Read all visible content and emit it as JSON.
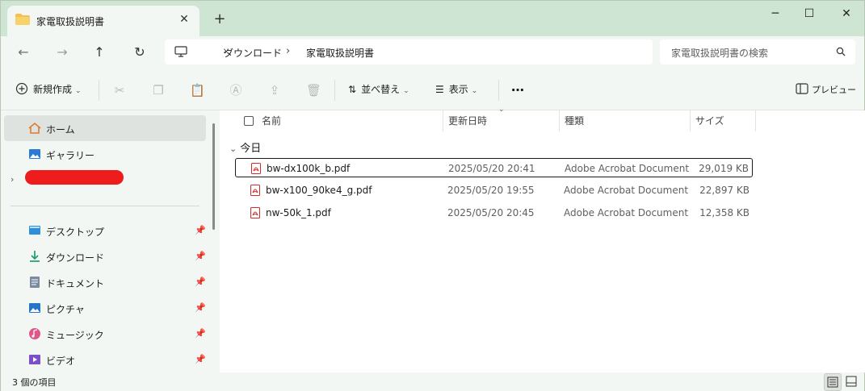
{
  "window": {
    "tab_title": "家電取扱説明書",
    "tab_close": "✕",
    "new_tab": "+",
    "controls": {
      "minimize": "─",
      "maximize": "☐",
      "close": "✕"
    }
  },
  "address": {
    "crumbs": [
      "ダウンロード",
      "家電取扱説明書"
    ],
    "separator": "›",
    "search_placeholder": "家電取扱説明書の検索"
  },
  "commands": {
    "new": "新規作成",
    "sort": "並べ替え",
    "view": "表示",
    "more": "…",
    "preview": "プレビュー"
  },
  "sidebar": {
    "top_items": [
      {
        "label": "ホーム",
        "icon": "home-icon",
        "selected": true
      },
      {
        "label": "ギャラリー",
        "icon": "gallery-icon",
        "selected": false
      }
    ],
    "pinned_items": [
      {
        "label": "デスクトップ",
        "icon": "desktop-icon"
      },
      {
        "label": "ダウンロード",
        "icon": "download-icon"
      },
      {
        "label": "ドキュメント",
        "icon": "documents-icon"
      },
      {
        "label": "ピクチャ",
        "icon": "pictures-icon"
      },
      {
        "label": "ミュージック",
        "icon": "music-icon"
      },
      {
        "label": "ビデオ",
        "icon": "videos-icon"
      }
    ]
  },
  "list": {
    "columns": [
      "名前",
      "更新日時",
      "種類",
      "サイズ"
    ],
    "group": "今日",
    "rows": [
      {
        "name": "bw-dx100k_b.pdf",
        "date": "2025/05/20 20:41",
        "type": "Adobe Acrobat Document",
        "size": "29,019 KB"
      },
      {
        "name": "bw-x100_90ke4_g.pdf",
        "date": "2025/05/20 19:55",
        "type": "Adobe Acrobat Document",
        "size": "22,897 KB"
      },
      {
        "name": "nw-50k_1.pdf",
        "date": "2025/05/20 20:45",
        "type": "Adobe Acrobat Document",
        "size": "12,358 KB"
      }
    ]
  },
  "status": {
    "count": "3 個の項目"
  },
  "colors": {
    "accent": "#1a7f37",
    "pdf_red": "#d42a2a",
    "redaction": "#ee1c1c"
  }
}
